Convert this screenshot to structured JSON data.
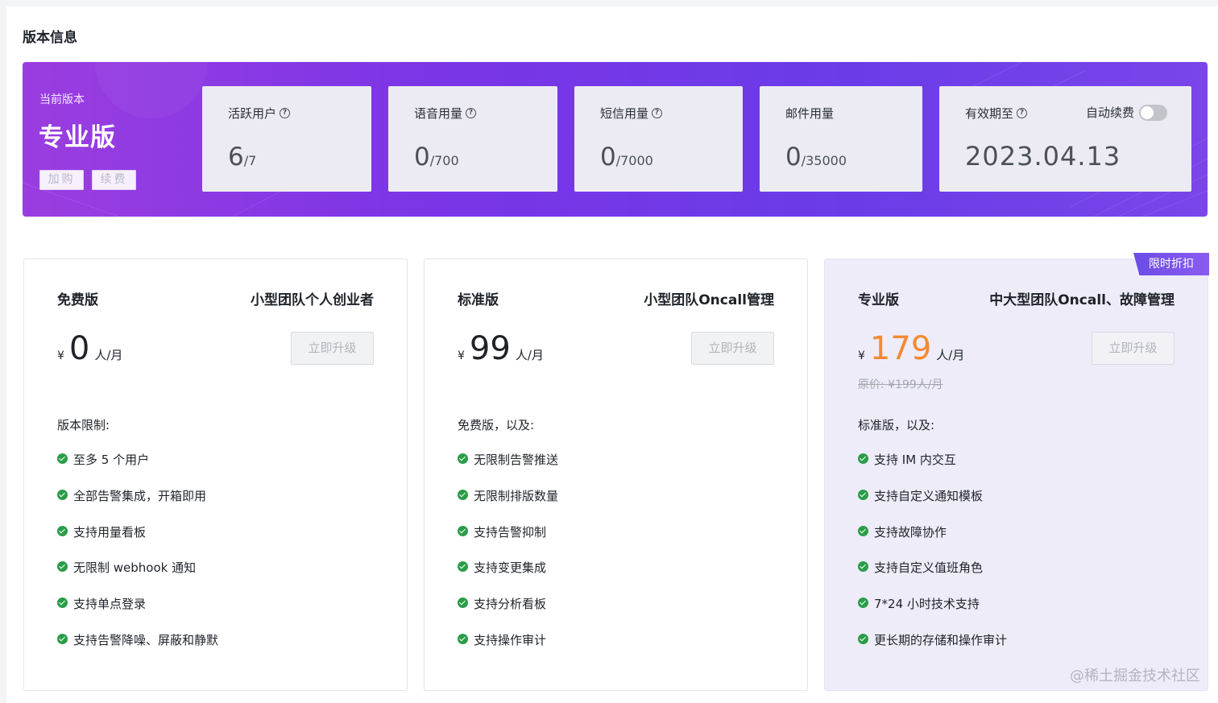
{
  "section_title": "版本信息",
  "banner": {
    "current_label": "当前版本",
    "current_name": "专业版",
    "buy_label": "加购",
    "renew_label": "续费",
    "stats": [
      {
        "label": "活跃用户",
        "value": "6",
        "total": "/7",
        "help": true
      },
      {
        "label": "语音用量",
        "value": "0",
        "total": "/700",
        "help": true
      },
      {
        "label": "短信用量",
        "value": "0",
        "total": "/7000",
        "help": true
      },
      {
        "label": "邮件用量",
        "value": "0",
        "total": "/35000",
        "help": false
      }
    ],
    "expiry": {
      "label": "有效期至",
      "date": "2023.04.13",
      "auto_renew_label": "自动续费",
      "auto_renew": false
    }
  },
  "plans": [
    {
      "name": "免费版",
      "tagline": "小型团队个人创业者",
      "currency": "¥",
      "price": "0",
      "unit": "人/月",
      "upgrade_label": "立即升级",
      "features_head": "版本限制:",
      "features": [
        "至多 5 个用户",
        "全部告警集成，开箱即用",
        "支持用量看板",
        "无限制 webhook 通知",
        "支持单点登录",
        "支持告警降噪、屏蔽和静默"
      ]
    },
    {
      "name": "标准版",
      "tagline": "小型团队Oncall管理",
      "currency": "¥",
      "price": "99",
      "unit": "人/月",
      "upgrade_label": "立即升级",
      "features_head": "免费版，以及:",
      "features": [
        "无限制告警推送",
        "无限制排版数量",
        "支持告警抑制",
        "支持变更集成",
        "支持分析看板",
        "支持操作审计"
      ]
    },
    {
      "name": "专业版",
      "tagline": "中大型团队Oncall、故障管理",
      "currency": "¥",
      "price": "179",
      "unit": "人/月",
      "original_price": "原价: ¥199人/月",
      "ribbon": "限时折扣",
      "upgrade_label": "立即升级",
      "features_head": "标准版，以及:",
      "features": [
        "支持 IM 内交互",
        "支持自定义通知模板",
        "支持故障协作",
        "支持自定义值班角色",
        "7*24 小时技术支持",
        "更长期的存储和操作审计"
      ]
    }
  ],
  "watermark": "@稀土掘金技术社区",
  "colors": {
    "banner_start": "#9b3de0",
    "banner_end": "#6a3ce8",
    "price_accent": "#f58a32",
    "check_green": "#2a9d48"
  }
}
